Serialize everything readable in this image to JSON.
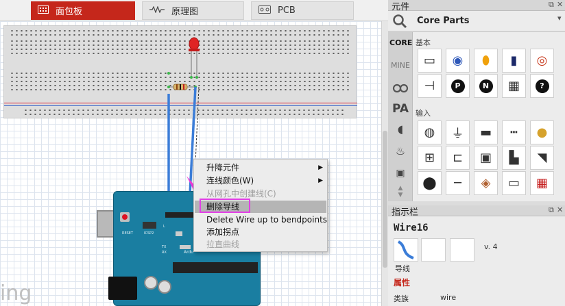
{
  "tabs": [
    {
      "label": "面包板",
      "active": true
    },
    {
      "label": "原理图",
      "active": false
    },
    {
      "label": "PCB",
      "active": false
    }
  ],
  "canvas": {
    "watermark": "ing"
  },
  "context_menu": {
    "items": [
      {
        "label": "升降元件",
        "enabled": true,
        "submenu": true
      },
      {
        "label": "连线颜色(W)",
        "enabled": true,
        "submenu": true
      },
      {
        "label": "从网孔中创建线(C)",
        "enabled": false,
        "submenu": false
      },
      {
        "label": "删除导线",
        "enabled": true,
        "submenu": false,
        "highlighted": true
      },
      {
        "label": "Delete Wire up to bendpoints",
        "enabled": true,
        "submenu": false
      },
      {
        "label": "添加拐点",
        "enabled": true,
        "submenu": false
      },
      {
        "label": "拉直曲线",
        "enabled": false,
        "submenu": false
      }
    ],
    "highlight_color": "#e23ee6"
  },
  "parts_bin": {
    "panel_title": "元件",
    "bin_title": "Core Parts",
    "bins": [
      {
        "label": "CORE",
        "icon": "core-text"
      },
      {
        "label": "MINE",
        "icon": "mine-text"
      },
      {
        "label": "",
        "icon": "arduino-infinity-icon"
      },
      {
        "label": "",
        "icon": "pa-icon"
      },
      {
        "label": "",
        "icon": "elephant-icon"
      },
      {
        "label": "",
        "icon": "flame-icon"
      },
      {
        "label": "",
        "icon": "robot-icon"
      }
    ],
    "categories": [
      {
        "label": "基本"
      },
      {
        "label": "输入"
      }
    ],
    "parts_row1": [
      {
        "name": "resistor-icon"
      },
      {
        "name": "ceramic-capacitor-icon"
      },
      {
        "name": "tantalum-capacitor-icon"
      },
      {
        "name": "electrolytic-capacitor-icon"
      },
      {
        "name": "inductor-icon"
      }
    ],
    "parts_row2": [
      {
        "name": "diode-icon"
      },
      {
        "name": "pnp-transistor-icon",
        "label": "P"
      },
      {
        "name": "npn-transistor-icon",
        "label": "N"
      },
      {
        "name": "mosfet-icon"
      },
      {
        "name": "mystery-part-icon",
        "label": "?"
      }
    ],
    "parts_row3": [
      {
        "name": "potentiometer-icon"
      },
      {
        "name": "rotary-pot-icon"
      },
      {
        "name": "slide-pot-icon"
      },
      {
        "name": "pin-header-icon"
      },
      {
        "name": "piezo-icon"
      }
    ],
    "parts_row4": [
      {
        "name": "rotary-encoder-icon"
      },
      {
        "name": "reed-switch-icon"
      },
      {
        "name": "pushbutton-icon"
      },
      {
        "name": "toggle-switch-icon"
      },
      {
        "name": "tilt-switch-icon"
      }
    ],
    "parts_row5": [
      {
        "name": "fsr-icon"
      },
      {
        "name": "flex-sensor-icon"
      },
      {
        "name": "photocell-icon"
      },
      {
        "name": "ir-sensor-icon"
      },
      {
        "name": "sensor-board-icon"
      }
    ]
  },
  "inspector": {
    "panel_title": "指示栏",
    "title": "Wire16",
    "version": "v. 4",
    "caption": "导线",
    "properties_label": "属性",
    "family_label": "类族",
    "family_value": "wire"
  },
  "colors": {
    "active_tab": "#c5271b",
    "wire_blue": "#3b7dd8",
    "arduino": "#1a7ea1",
    "led": "#e02424"
  }
}
